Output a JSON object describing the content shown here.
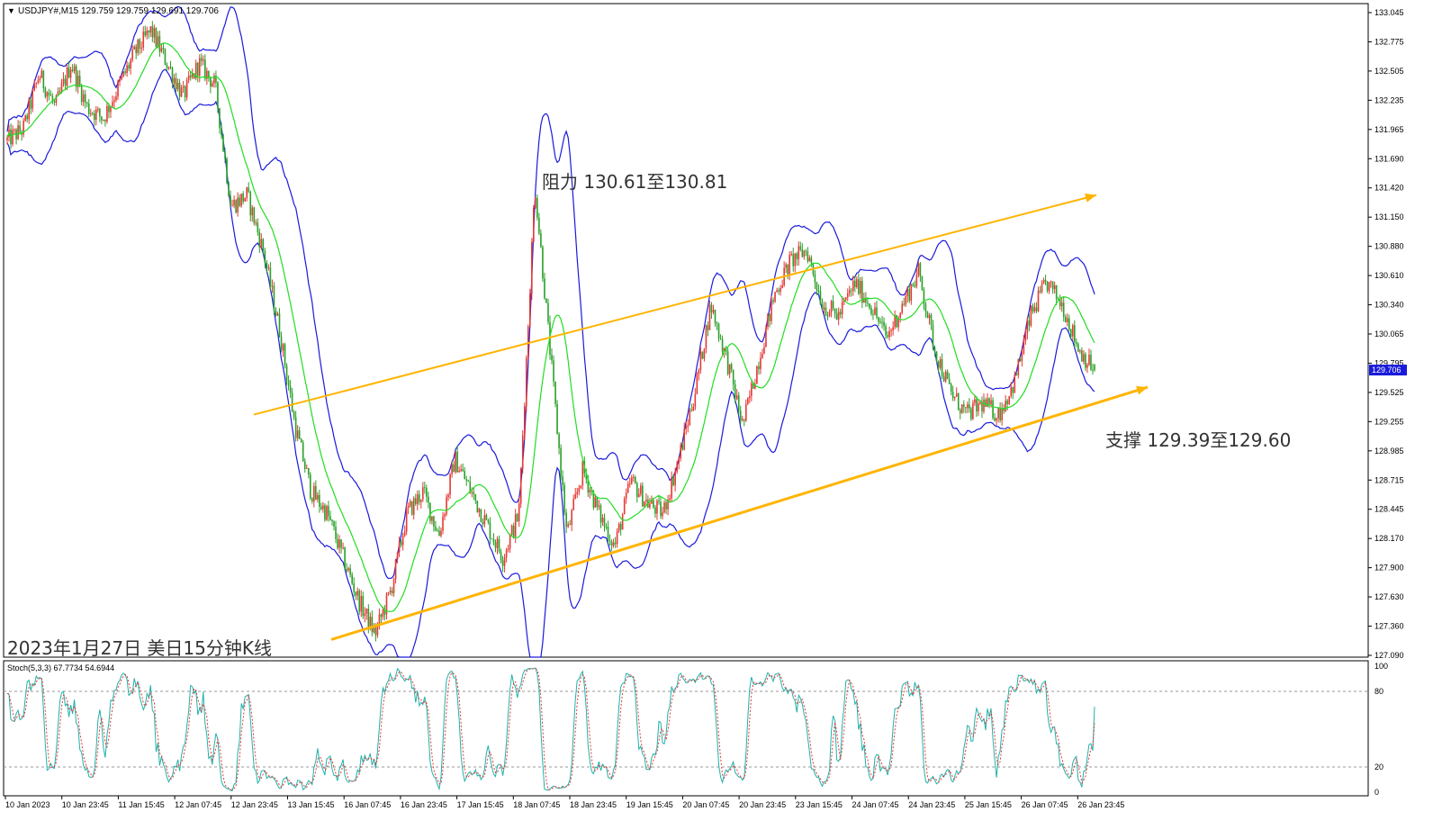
{
  "header": {
    "symbol_line": "USDJPY#,M15  129.759 129.759 129.691 129.706"
  },
  "annotations": {
    "resistance": "阻力 130.61至130.81",
    "support": "支撑 129.39至129.60",
    "date_caption": "2023年1月27日 美日15分钟K线"
  },
  "price_axis": {
    "labels": [
      "133.045",
      "132.775",
      "132.505",
      "132.235",
      "131.965",
      "131.690",
      "131.420",
      "131.150",
      "130.880",
      "130.610",
      "130.340",
      "130.065",
      "129.795",
      "129.525",
      "129.255",
      "128.985",
      "128.715",
      "128.445",
      "128.170",
      "127.900",
      "127.630",
      "127.360",
      "127.090"
    ],
    "current_price": "129.706"
  },
  "stoch": {
    "label": "Stoch(5,3,3) 67.7734 54.6944",
    "levels": [
      "100",
      "80",
      "20",
      "0"
    ]
  },
  "time_axis": {
    "labels": [
      "10 Jan 2023",
      "10 Jan 23:45",
      "11 Jan 15:45",
      "12 Jan 07:45",
      "12 Jan 23:45",
      "13 Jan 15:45",
      "16 Jan 07:45",
      "16 Jan 23:45",
      "17 Jan 15:45",
      "18 Jan 07:45",
      "18 Jan 23:45",
      "19 Jan 15:45",
      "20 Jan 07:45",
      "20 Jan 23:45",
      "23 Jan 15:45",
      "24 Jan 07:45",
      "24 Jan 23:45",
      "25 Jan 15:45",
      "26 Jan 07:45",
      "26 Jan 23:45"
    ]
  },
  "colors": {
    "candle_up": "#e53935",
    "candle_down": "#2aa02a",
    "ma_line": "#22dd22",
    "bollinger": "#1a1adc",
    "channel": "#ffb400",
    "stoch_main": "#20b2aa",
    "stoch_signal": "#e53935",
    "price_tag_bg": "#1a1adc"
  },
  "chart_data": {
    "type": "candlestick",
    "symbol": "USDJPY#",
    "timeframe": "M15",
    "ylim": [
      127.09,
      133.045
    ],
    "ohlc_last": {
      "open": 129.759,
      "high": 129.759,
      "low": 129.691,
      "close": 129.706
    },
    "path_points": [
      [
        0,
        131.8
      ],
      [
        8,
        131.9
      ],
      [
        16,
        132.4
      ],
      [
        24,
        132.1
      ],
      [
        32,
        132.5
      ],
      [
        40,
        132.1
      ],
      [
        48,
        132.0
      ],
      [
        56,
        132.3
      ],
      [
        64,
        132.6
      ],
      [
        72,
        132.8
      ],
      [
        80,
        132.5
      ],
      [
        88,
        132.2
      ],
      [
        96,
        132.5
      ],
      [
        104,
        132.3
      ],
      [
        112,
        131.2
      ],
      [
        120,
        131.3
      ],
      [
        128,
        130.8
      ],
      [
        136,
        130.1
      ],
      [
        144,
        129.2
      ],
      [
        152,
        128.6
      ],
      [
        160,
        128.4
      ],
      [
        168,
        128.0
      ],
      [
        176,
        127.6
      ],
      [
        184,
        127.3
      ],
      [
        192,
        127.7
      ],
      [
        200,
        128.4
      ],
      [
        208,
        128.6
      ],
      [
        216,
        128.2
      ],
      [
        224,
        128.9
      ],
      [
        232,
        128.6
      ],
      [
        240,
        128.3
      ],
      [
        248,
        128.0
      ],
      [
        256,
        128.4
      ],
      [
        264,
        131.4
      ],
      [
        272,
        129.8
      ],
      [
        280,
        128.2
      ],
      [
        288,
        128.8
      ],
      [
        296,
        128.4
      ],
      [
        304,
        128.1
      ],
      [
        312,
        128.7
      ],
      [
        320,
        128.5
      ],
      [
        328,
        128.4
      ],
      [
        336,
        128.9
      ],
      [
        344,
        129.5
      ],
      [
        352,
        130.3
      ],
      [
        360,
        129.8
      ],
      [
        368,
        129.2
      ],
      [
        376,
        129.8
      ],
      [
        384,
        130.4
      ],
      [
        392,
        130.7
      ],
      [
        400,
        130.8
      ],
      [
        408,
        130.3
      ],
      [
        416,
        130.2
      ],
      [
        424,
        130.5
      ],
      [
        432,
        130.3
      ],
      [
        440,
        130.0
      ],
      [
        448,
        130.3
      ],
      [
        456,
        130.6
      ],
      [
        464,
        129.9
      ],
      [
        472,
        129.5
      ],
      [
        480,
        129.3
      ],
      [
        488,
        129.4
      ],
      [
        496,
        129.3
      ],
      [
        504,
        129.6
      ],
      [
        512,
        130.2
      ],
      [
        520,
        130.5
      ],
      [
        528,
        130.3
      ],
      [
        536,
        129.9
      ],
      [
        544,
        129.7
      ]
    ],
    "path_x_range": [
      0,
      544
    ],
    "channel": {
      "resistance_line": {
        "start": [
          0,
          129.3
        ],
        "end": [
          544,
          131.3
        ]
      },
      "support_line": {
        "start": [
          0,
          127.25
        ],
        "end": [
          544,
          129.55
        ]
      }
    },
    "resistance_zone": [
      130.61,
      130.81
    ],
    "support_zone": [
      129.39,
      129.6
    ],
    "indicators": [
      "Bollinger Bands",
      "Moving Average",
      "Stochastic(5,3,3)"
    ],
    "stoch_values": {
      "main": 67.7734,
      "signal": 54.6944,
      "levels": [
        20,
        80
      ]
    }
  }
}
